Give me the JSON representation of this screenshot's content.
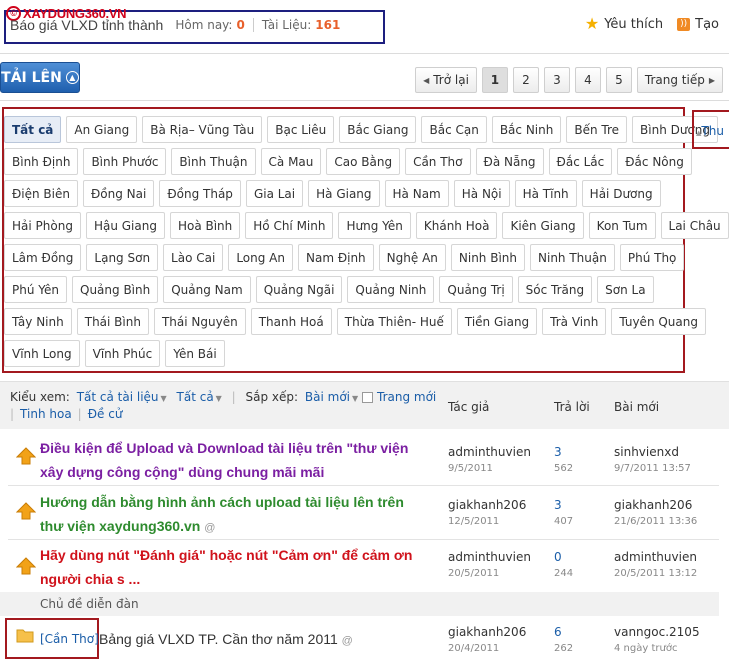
{
  "header": {
    "logo_text": "XAYDUNG360.VN",
    "logo_mark": "©",
    "page_title": "Báo giá VLXD tỉnh thành",
    "today_label": "Hôm nay:",
    "today_count": "0",
    "docs_label": "Tài Liệu:",
    "docs_count": "161",
    "favorite_label": "Yêu thích",
    "create_label": "Tạo",
    "favorite_icon": "star-icon",
    "create_icon": "rss-icon"
  },
  "toolbar": {
    "upload_label": "TẢI LÊN",
    "pager": {
      "prev": "Trở lại",
      "pages": [
        "1",
        "2",
        "3",
        "4",
        "5"
      ],
      "next": "Trang tiếp",
      "current": "1"
    }
  },
  "tags": {
    "rows": [
      [
        "Tất cả",
        "An Giang",
        "Bà Rịa– Vũng Tàu",
        "Bạc Liêu",
        "Bắc Giang",
        "Bắc Cạn",
        "Bắc Ninh",
        "Bến Tre",
        "Bình Dương"
      ],
      [
        "Bình Định",
        "Bình Phước",
        "Bình Thuận",
        "Cà Mau",
        "Cao Bằng",
        "Cần Thơ",
        "Đà Nẵng",
        "Đắc Lắc",
        "Đắc Nông"
      ],
      [
        "Điện Biên",
        "Đồng Nai",
        "Đồng Tháp",
        "Gia Lai",
        "Hà Giang",
        "Hà Nam",
        "Hà Nội",
        "Hà Tĩnh",
        "Hải Dương"
      ],
      [
        "Hải Phòng",
        "Hậu Giang",
        "Hoà Bình",
        "Hồ Chí Minh",
        "Hưng Yên",
        "Khánh Hoà",
        "Kiên Giang",
        "Kon Tum",
        "Lai Châu"
      ],
      [
        "Lâm Đồng",
        "Lạng Sơn",
        "Lào Cai",
        "Long An",
        "Nam Định",
        "Nghệ An",
        "Ninh Bình",
        "Ninh Thuận",
        "Phú Thọ"
      ],
      [
        "Phú Yên",
        "Quảng Bình",
        "Quảng Nam",
        "Quảng Ngãi",
        "Quảng Ninh",
        "Quảng Trị",
        "Sóc Trăng",
        "Sơn La"
      ],
      [
        "Tây Ninh",
        "Thái Bình",
        "Thái Nguyên",
        "Thanh Hoá",
        "Thừa Thiên- Huế",
        "Tiền Giang",
        "Trà Vinh",
        "Tuyên Quang"
      ],
      [
        "Vĩnh Long",
        "Vĩnh Phúc",
        "Yên Bái"
      ]
    ],
    "active": "Tất cả",
    "collapse_label": "Thu"
  },
  "filters": {
    "view_label": "Kiểu xem:",
    "view_value": "Tất cả tài liệu",
    "scope_value": "Tất cả",
    "sort_label": "Sắp xếp:",
    "sort_value": "Bài mới",
    "new_page_label": "Trang mới",
    "best_label": "Tinh hoa",
    "pinned_label": "Đề cử"
  },
  "columns": {
    "author": "Tác giả",
    "replies": "Trả lời",
    "last_post": "Bài mới"
  },
  "threads": [
    {
      "title": "Điều kiện để Upload và Download tài liệu trên \"thư viện xây dựng công cộng\" dùng chung mãi mãi",
      "author": "adminthuvien",
      "date": "9/5/2011",
      "replies": "3",
      "views": "562",
      "last_user": "sinhvienxd",
      "last_date": "9/7/2011 13:57",
      "color": "#7b1fa2"
    },
    {
      "title": "Hướng dẫn bằng hình ảnh cách upload tài liệu lên trên thư viện xaydung360.vn",
      "author": "giakhanh206",
      "date": "12/5/2011",
      "replies": "3",
      "views": "407",
      "last_user": "giakhanh206",
      "last_date": "21/6/2011 13:36",
      "color": "#2e8b2e"
    },
    {
      "title": "Hãy dùng nút \"Đánh giá\" hoặc nút \"Cảm ơn\" để cảm ơn người chia s ...",
      "author": "adminthuvien",
      "date": "20/5/2011",
      "replies": "0",
      "views": "244",
      "last_user": "adminthuvien",
      "last_date": "20/5/2011 13:12",
      "color": "#d0121b"
    }
  ],
  "section_label": "Chủ đề diễn đàn",
  "forum_thread": {
    "prefix": "[Cần Thơ]",
    "title": "Bảng giá VLXD TP. Cần thơ năm 2011",
    "author": "giakhanh206",
    "date": "20/4/2011",
    "replies": "6",
    "views": "262",
    "last_user": "vanngoc.2105",
    "last_date": "4  ngày trước"
  }
}
